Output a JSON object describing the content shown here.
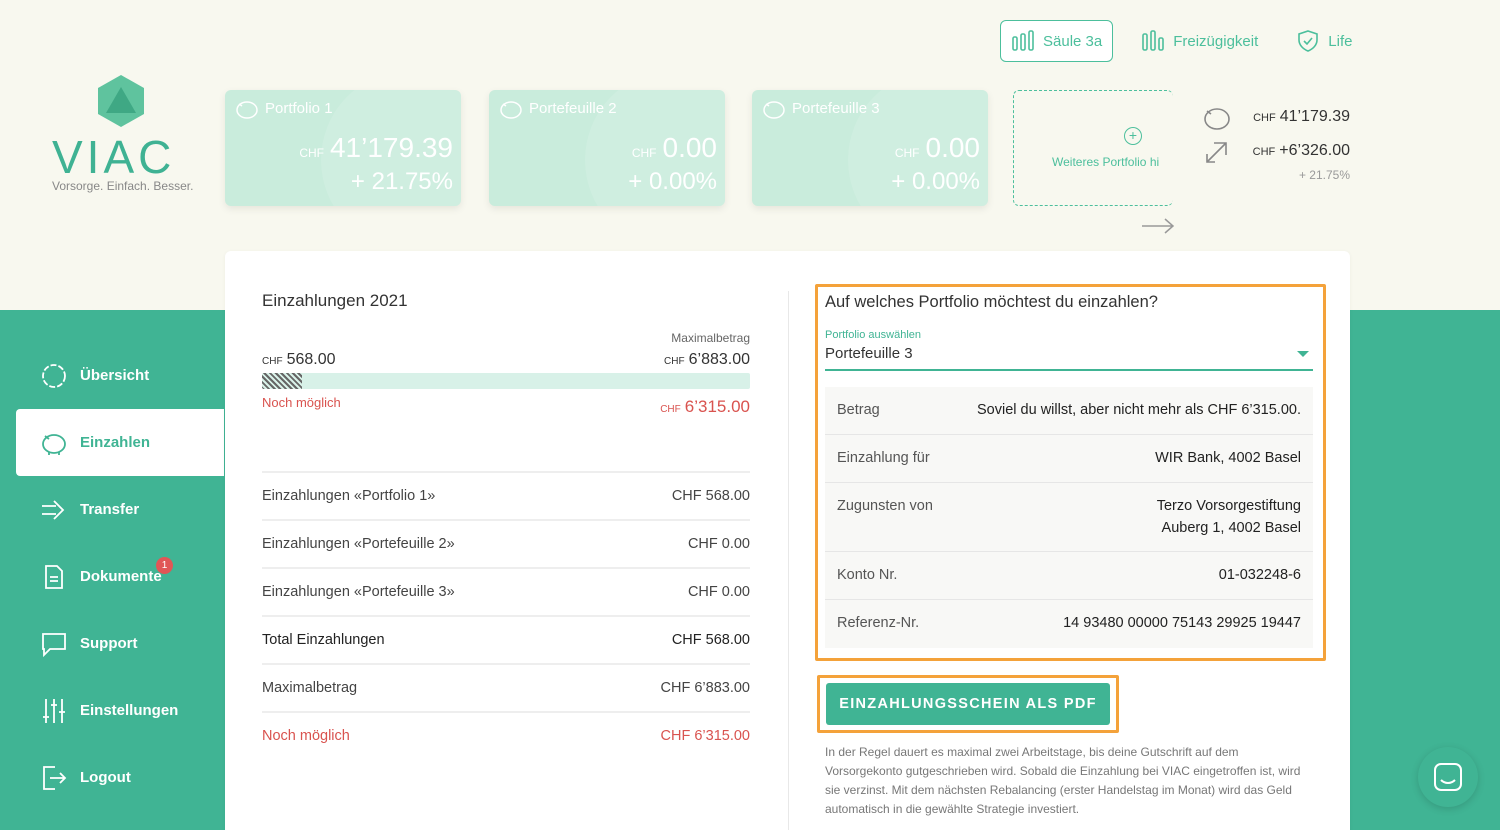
{
  "brand": {
    "name": "VIAC",
    "tagline": "Vorsorge. Einfach. Besser.",
    "accent": "#40b494"
  },
  "topnav": [
    {
      "label": "Säule 3a",
      "active": true
    },
    {
      "label": "Freizügigkeit",
      "active": false
    },
    {
      "label": "Life",
      "active": false
    }
  ],
  "portfolios": [
    {
      "title": "Portfolio 1",
      "currency": "CHF",
      "amount": "41’179.39",
      "perf": "+ 21.75%"
    },
    {
      "title": "Portefeuille 2",
      "currency": "CHF",
      "amount": "0.00",
      "perf": "+ 0.00%"
    },
    {
      "title": "Portefeuille 3",
      "currency": "CHF",
      "amount": "0.00",
      "perf": "+ 0.00%"
    }
  ],
  "add_portfolio": "Weiteres Portfolio hi",
  "summary": {
    "total_currency": "CHF",
    "total": "41’179.39",
    "gain_currency": "CHF",
    "gain": "+6’326.00",
    "gain_perf": "+ 21.75%"
  },
  "sidebar": [
    {
      "label": "Übersicht",
      "icon": "circle-icon"
    },
    {
      "label": "Einzahlen",
      "icon": "piggybank-icon",
      "active": true
    },
    {
      "label": "Transfer",
      "icon": "transfer-icon"
    },
    {
      "label": "Dokumente",
      "icon": "document-icon",
      "badge": "1"
    },
    {
      "label": "Support",
      "icon": "chat-icon"
    },
    {
      "label": "Einstellungen",
      "icon": "sliders-icon"
    },
    {
      "label": "Logout",
      "icon": "logout-icon"
    }
  ],
  "deposits": {
    "title": "Einzahlungen 2021",
    "max_label": "Maximalbetrag",
    "current_currency": "CHF",
    "current": "568.00",
    "max_currency": "CHF",
    "max": "6’883.00",
    "progress": 0.0825,
    "remaining_label": "Noch möglich",
    "remaining_currency": "CHF",
    "remaining": "6’315.00",
    "rows": [
      {
        "label": "Einzahlungen «Portfolio 1»",
        "value": "CHF 568.00"
      },
      {
        "label": "Einzahlungen «Portefeuille 2»",
        "value": "CHF 0.00"
      },
      {
        "label": "Einzahlungen «Portefeuille 3»",
        "value": "CHF 0.00"
      },
      {
        "label": "Total Einzahlungen",
        "value": "CHF 568.00"
      },
      {
        "label": "Maximalbetrag",
        "value": "CHF 6’883.00"
      },
      {
        "label": "Noch möglich",
        "value": "CHF 6’315.00"
      }
    ]
  },
  "payment": {
    "question": "Auf welches Portfolio möchtest du einzahlen?",
    "select_label": "Portfolio auswählen",
    "select_value": "Portefeuille 3",
    "rows": [
      {
        "key": "Betrag",
        "value": "Soviel du willst, aber nicht mehr als CHF 6’315.00."
      },
      {
        "key": "Einzahlung für",
        "value": "WIR Bank, 4002 Basel"
      },
      {
        "key": "Zugunsten von",
        "value": "Terzo Vorsorgestiftung",
        "value2": "Auberg 1, 4002 Basel"
      },
      {
        "key": "Konto Nr.",
        "value": "01-032248-6"
      },
      {
        "key": "Referenz-Nr.",
        "value": "14 93480 00000 75143 29925 19447"
      }
    ],
    "pdf_button": "EINZAHLUNGSSCHEIN ALS PDF",
    "note": "In der Regel dauert es maximal zwei Arbeitstage, bis deine Gutschrift auf dem Vorsorgekonto gutgeschrieben wird. Sobald die Einzahlung bei VIAC eingetroffen ist, wird sie verzinst. Mit dem nächsten Rebalancing (erster Handelstag im Monat) wird das Geld automatisch in die gewählte Strategie investiert."
  }
}
